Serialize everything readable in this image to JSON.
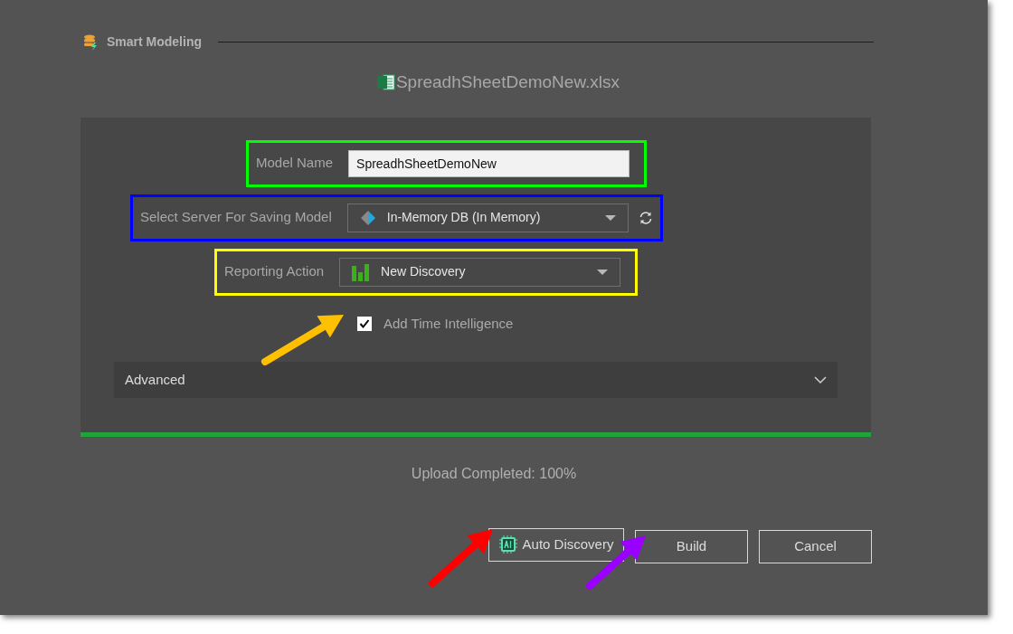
{
  "header": {
    "title": "Smart Modeling"
  },
  "file": {
    "name": "SpreadhSheetDemoNew.xlsx"
  },
  "fields": [
    {
      "kind": "text_input",
      "label": "Model Name",
      "value": "SpreadhSheetDemoNew",
      "color": "#00ff00"
    },
    {
      "kind": "select",
      "label": "Select Server For Saving Model",
      "value": "In-Memory DB (In Memory)",
      "refresh": true,
      "color": "#0000ff"
    },
    {
      "kind": "select",
      "label": "Reporting Action",
      "value": "New Discovery",
      "refresh": false,
      "color": "#ffff00"
    }
  ],
  "time_intelligence": {
    "label": "Add Time Intelligence",
    "checked": true
  },
  "advanced": {
    "label": "Advanced",
    "expanded": false
  },
  "progress": {
    "level": 1.0,
    "status": "Upload Completed: 100%"
  },
  "buttons": [
    {
      "kind": "ai",
      "label": "Auto Discovery"
    },
    {
      "kind": "plain",
      "label": "Build"
    },
    {
      "kind": "plain",
      "label": "Cancel"
    }
  ],
  "annotation_arrows": [
    {
      "color": "#ffc000"
    },
    {
      "color": "#ff0000"
    },
    {
      "color": "#9900ff"
    }
  ]
}
